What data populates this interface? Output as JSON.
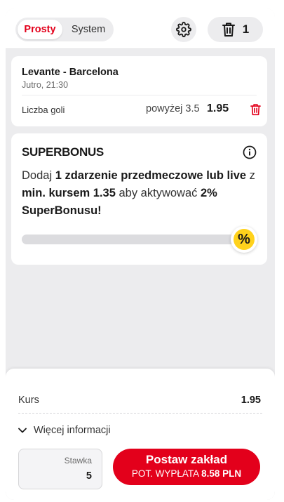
{
  "header": {
    "mode_tabs": [
      "Prosty",
      "System"
    ],
    "active_tab": "Prosty",
    "bet_count": "1"
  },
  "bet": {
    "home_team": "Levante",
    "separator": "-",
    "away_team": "Barcelona",
    "time": "Jutro, 21:30",
    "market": "Liczba goli",
    "selection": "powyżej 3.5",
    "odds": "1.95"
  },
  "superbonus": {
    "title": "SUPERBONUS",
    "text_part1": "Dodaj ",
    "text_bold1": "1 zdarzenie przedmeczowe lub live",
    "text_part2": " z ",
    "text_bold2": "min. kursem 1.35",
    "text_part3": " aby aktywować ",
    "text_bold3": "2%",
    "text_part4": " ",
    "text_bold4": "SuperBonusu!",
    "progress": 0,
    "badge_symbol": "%"
  },
  "footer": {
    "kurs_label": "Kurs",
    "kurs_value": "1.95",
    "more_info_label": "Więcej informacji",
    "stake_label": "Stawka",
    "stake_value": "5",
    "place_bet_label": "Postaw zakład",
    "payout_label": "POT. WYPŁATA",
    "payout_value": "8.58 PLN"
  },
  "colors": {
    "accent_red": "#e3001b",
    "badge_yellow": "#ffd21c",
    "panel_bg": "#ececee"
  },
  "icons": {
    "settings": "gear-icon",
    "clear_all": "trash-icon",
    "remove_bet": "trash-icon",
    "info": "info-icon",
    "expand": "chevron-down-icon"
  }
}
